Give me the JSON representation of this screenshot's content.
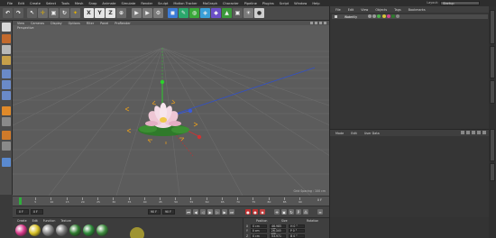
{
  "menubar": {
    "items": [
      "File",
      "Edit",
      "Create",
      "Select",
      "Tools",
      "Mesh",
      "Snap",
      "Animate",
      "Simulate",
      "Render",
      "Sculpt",
      "Motion Tracker",
      "MoGraph",
      "Character",
      "Pipeline",
      "Plugins",
      "Script",
      "Window",
      "Help"
    ],
    "layout_label": "Layout:",
    "layout_value": "Startup"
  },
  "toolbar": {
    "axis_x": "X",
    "axis_y": "Y",
    "axis_z": "Z"
  },
  "viewport": {
    "menu": [
      "View",
      "Cameras",
      "Display",
      "Options",
      "Filter",
      "Panel",
      "ProRender"
    ],
    "label": "Perspective",
    "footer": "Grid Spacing : 100 cm"
  },
  "timeline": {
    "ticks": [
      "0",
      "5",
      "10",
      "15",
      "20",
      "25",
      "30",
      "35",
      "40",
      "45",
      "50",
      "55",
      "60",
      "65",
      "70",
      "75",
      "80",
      "85",
      "90"
    ],
    "end_label": "0 F"
  },
  "transport": {
    "start_frame": "0 F",
    "current_frame": "0 F",
    "end_frame": "90 F",
    "max_frame": "90 F"
  },
  "materials": {
    "menu": [
      "Create",
      "Edit",
      "Function",
      "Texture"
    ],
    "colors": [
      "#d83a8a",
      "#d9c228",
      "#8a8a8a",
      "#7a7a7a",
      "#2f7a2f",
      "#2e8a3a",
      "#3f8c3f"
    ]
  },
  "coords": {
    "headers": [
      "Position",
      "Size",
      "Rotation"
    ],
    "rows": [
      {
        "axis": "X",
        "pos": "0 cm",
        "size": "46.985 cm",
        "rot": "H 0 °"
      },
      {
        "axis": "Y",
        "pos": "0 cm",
        "size": "26.345 cm",
        "rot": "P 0 °"
      },
      {
        "axis": "Z",
        "pos": "0 cm",
        "size": "53.971 cm",
        "rot": "B 0 °"
      }
    ]
  },
  "object_manager": {
    "menu": [
      "File",
      "Edit",
      "View",
      "Objects",
      "Tags",
      "Bookmarks"
    ],
    "object_name": "Waterlily"
  },
  "attribute_manager": {
    "menu": [
      "Mode",
      "Edit",
      "User Data"
    ]
  }
}
